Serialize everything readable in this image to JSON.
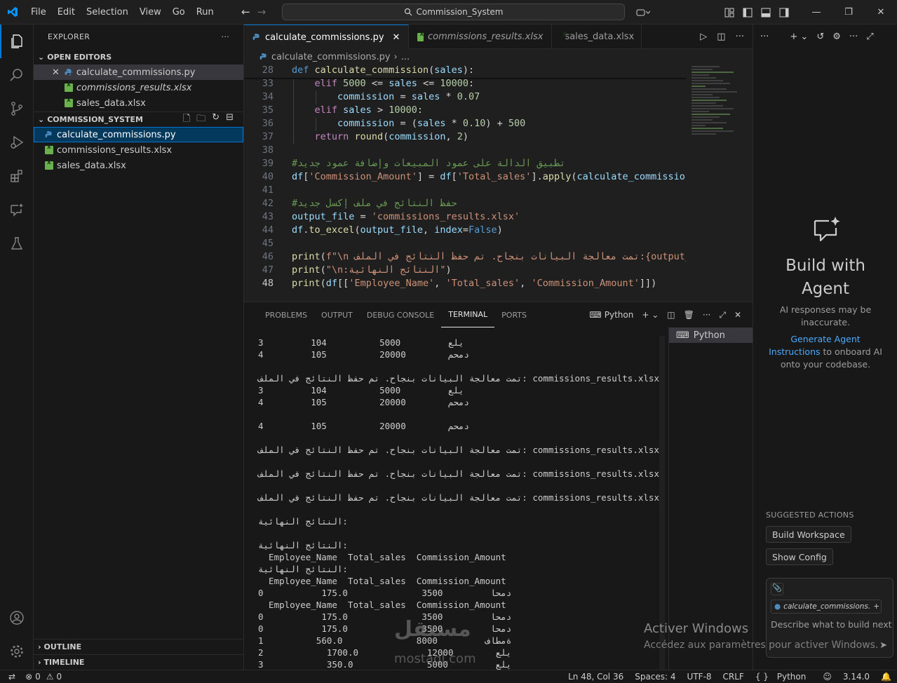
{
  "menu": [
    "File",
    "Edit",
    "Selection",
    "View",
    "Go",
    "Run"
  ],
  "search_title": "Commission_System",
  "explorer": {
    "title": "EXPLORER",
    "open_editors_label": "OPEN EDITORS",
    "open_editors": [
      "calculate_commissions.py",
      "commissions_results.xlsx",
      "sales_data.xlsx"
    ],
    "folder_label": "COMMISSION_SYSTEM",
    "files": [
      "calculate_commissions.py",
      "commissions_results.xlsx",
      "sales_data.xlsx"
    ],
    "outline_label": "OUTLINE",
    "timeline_label": "TIMELINE"
  },
  "tabs": [
    "calculate_commissions.py",
    "commissions_results.xlsx",
    "sales_data.xlsx"
  ],
  "breadcrumb": {
    "file": "calculate_commissions.py",
    "rest": "..."
  },
  "code": [
    {
      "n": "28",
      "t": "def calculate_commission(sales):"
    },
    {
      "n": "33",
      "t": "    elif 5000 <= sales <= 10000:"
    },
    {
      "n": "34",
      "t": "        commission = sales * 0.07"
    },
    {
      "n": "35",
      "t": "    elif sales > 10000:"
    },
    {
      "n": "36",
      "t": "        commission = (sales * 0.10) + 500"
    },
    {
      "n": "37",
      "t": "    return round(commission, 2)"
    },
    {
      "n": "38",
      "t": ""
    },
    {
      "n": "39",
      "t": "#تطبيق الدالة على عمود المبيعات وإضافة عمود جديد"
    },
    {
      "n": "40",
      "t": "df['Commission_Amount'] = df['Total_sales'].apply(calculate_commission)"
    },
    {
      "n": "41",
      "t": ""
    },
    {
      "n": "42",
      "t": "#حفظ النتائج في ملف إكسل جديد"
    },
    {
      "n": "43",
      "t": "output_file = 'commissions_results.xlsx'"
    },
    {
      "n": "44",
      "t": "df.to_excel(output_file, index=False)"
    },
    {
      "n": "45",
      "t": ""
    },
    {
      "n": "46",
      "t": "print(f\"\\n تمت معالجة البيانات بنجاح. تم حفظ النتائج في الملف:{output_"
    },
    {
      "n": "47",
      "t": "print(\"\\n:النتائج النهائية\")"
    },
    {
      "n": "48",
      "t": "print(df[['Employee_Name', 'Total_sales', 'Commission_Amount']])"
    }
  ],
  "panel": {
    "tabs": [
      "PROBLEMS",
      "OUTPUT",
      "DEBUG CONSOLE",
      "TERMINAL",
      "PORTS"
    ],
    "active": "TERMINAL",
    "shell": "Python",
    "terminal_list": [
      "Python"
    ]
  },
  "terminal": [
    "3         104          يلع         5000",
    "4         105          دمحم        20000",
    "",
    "تمت معالجة البيانات بنجاح. تم حفظ النتائج في الملف: commissions_results.xlsx",
    "3         104          يلع         5000",
    "4         105          دمحم        20000",
    "",
    "4         105          دمحم        20000",
    "",
    "تمت معالجة البيانات بنجاح. تم حفظ النتائج في الملف: commissions_results.xlsx",
    "",
    "تمت معالجة البيانات بنجاح. تم حفظ النتائج في الملف: commissions_results.xlsx",
    "",
    "تمت معالجة البيانات بنجاح. تم حفظ النتائج في الملف: commissions_results.xlsx",
    "",
    "النتائج النهائية:",
    "",
    "النتائج النهائية:",
    "  Employee_Name  Total_sales  Commission_Amount",
    "النتائج النهائية:",
    "  Employee_Name  Total_sales  Commission_Amount",
    "0           دمحا         3500              175.0",
    "  Employee_Name  Total_sales  Commission_Amount",
    "0           دمحا         3500              175.0",
    "0           دمحا         3500              175.0",
    "1          ةمطاف         8000              560.0",
    "2            يلع        12000             1700.0",
    "3            يلع         5000              350.0"
  ],
  "chat": {
    "title": "Build with Agent",
    "subtitle": "AI responses may be inaccurate.",
    "link": "Generate Agent Instructions",
    "link_rest": "to onboard AI onto your codebase.",
    "suggested_label": "SUGGESTED ACTIONS",
    "actions": [
      "Build Workspace",
      "Show Config"
    ],
    "context_file": "calculate_commissions.",
    "placeholder": "Describe what to build next"
  },
  "status": {
    "errors": "0",
    "warnings": "0",
    "position": "Ln 48, Col 36",
    "spaces": "Spaces: 4",
    "encoding": "UTF-8",
    "eol": "CRLF",
    "language": "Python",
    "version": "3.14.0"
  },
  "watermark": {
    "line1": "Activer Windows",
    "line2": "Accédez aux paramètres pour activer Windows."
  },
  "overlay_logo": {
    "ar": "مستقل",
    "en": "mostaql.com"
  }
}
